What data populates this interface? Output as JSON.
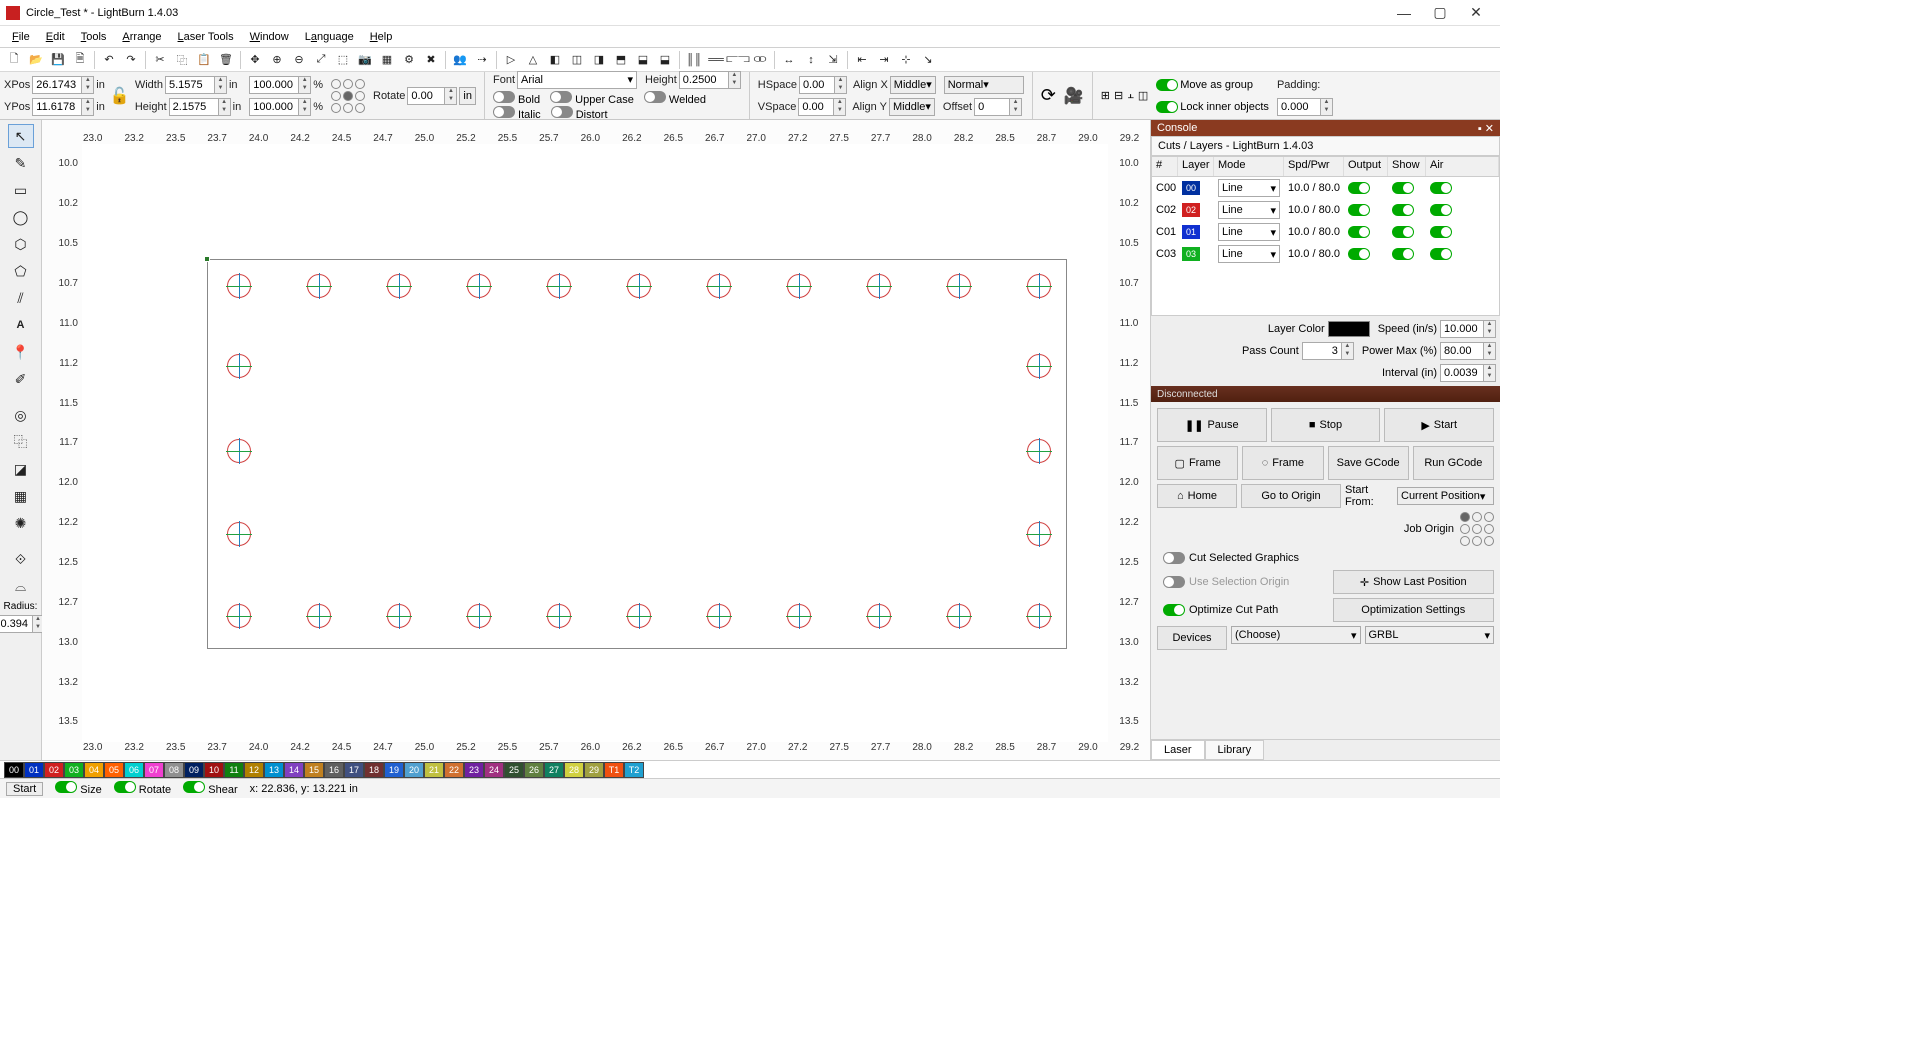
{
  "window": {
    "title": "Circle_Test * - LightBurn 1.4.03"
  },
  "menus": [
    "File",
    "Edit",
    "Tools",
    "Arrange",
    "Laser Tools",
    "Window",
    "Language",
    "Help"
  ],
  "props": {
    "xpos_label": "XPos",
    "xpos": "26.1743",
    "xpos_unit": "in",
    "ypos_label": "YPos",
    "ypos": "11.6178",
    "ypos_unit": "in",
    "width_label": "Width",
    "width": "5.1575",
    "width_unit": "in",
    "height_label": "Height",
    "height": "2.1575",
    "height_unit": "in",
    "scale_x": "100.000",
    "scale_x_unit": "%",
    "scale_y": "100.000",
    "scale_y_unit": "%",
    "rotate_label": "Rotate",
    "rotate": "0.00",
    "rotate_unit": "in",
    "font_label": "Font",
    "font": "Arial",
    "fheight_label": "Height",
    "fheight": "0.2500",
    "bold": "Bold",
    "italic": "Italic",
    "upper": "Upper Case",
    "distort": "Distort",
    "welded": "Welded",
    "hspace_label": "HSpace",
    "hspace": "0.00",
    "vspace_label": "VSpace",
    "vspace": "0.00",
    "alignx_label": "Align X",
    "alignx": "Middle",
    "aligny_label": "Align Y",
    "aligny": "Middle",
    "normal": "Normal",
    "offset_label": "Offset",
    "offset": "0",
    "move_as_group": "Move as group",
    "lock_inner": "Lock inner objects",
    "padding_label": "Padding:",
    "padding": "0.000"
  },
  "ruler_top": [
    "23.0",
    "23.2",
    "23.5",
    "23.7",
    "24.0",
    "24.2",
    "24.5",
    "24.7",
    "25.0",
    "25.2",
    "25.5",
    "25.7",
    "26.0",
    "26.2",
    "26.5",
    "26.7",
    "27.0",
    "27.2",
    "27.5",
    "27.7",
    "28.0",
    "28.2",
    "28.5",
    "28.7",
    "29.0",
    "29.2"
  ],
  "ruler_left": [
    "10.0",
    "10.2",
    "10.5",
    "10.7",
    "11.0",
    "11.2",
    "11.5",
    "11.7",
    "12.0",
    "12.2",
    "12.5",
    "12.7",
    "13.0",
    "13.2",
    "13.5"
  ],
  "cuts": {
    "title": "Cuts / Layers - LightBurn 1.4.03",
    "headers": [
      "#",
      "Layer",
      "Mode",
      "Spd/Pwr",
      "Output",
      "Show",
      "Air"
    ],
    "rows": [
      {
        "id": "C00",
        "label": "00",
        "color": "#0030a0",
        "mode": "Line",
        "spdpwr": "10.0 / 80.0"
      },
      {
        "id": "C02",
        "label": "02",
        "color": "#d02020",
        "mode": "Line",
        "spdpwr": "10.0 / 80.0"
      },
      {
        "id": "C01",
        "label": "01",
        "color": "#1030d0",
        "mode": "Line",
        "spdpwr": "10.0 / 80.0"
      },
      {
        "id": "C03",
        "label": "03",
        "color": "#10b020",
        "mode": "Line",
        "spdpwr": "10.0 / 80.0"
      }
    ],
    "layer_color_label": "Layer Color",
    "speed_label": "Speed (in/s)",
    "speed": "10.000",
    "pass_label": "Pass Count",
    "pass": "3",
    "power_label": "Power Max (%)",
    "power": "80.00",
    "interval_label": "Interval (in)",
    "interval": "0.0039"
  },
  "laser": {
    "disconnected": "Disconnected",
    "console": "Console",
    "pause": "Pause",
    "stop": "Stop",
    "start": "Start",
    "frame": "Frame",
    "save_gcode": "Save GCode",
    "run_gcode": "Run GCode",
    "home": "Home",
    "go_origin": "Go to Origin",
    "start_from": "Start From:",
    "start_from_val": "Current Position",
    "job_origin": "Job Origin",
    "cut_sel": "Cut Selected Graphics",
    "use_sel_origin": "Use Selection Origin",
    "show_last": "Show Last Position",
    "optimize": "Optimize Cut Path",
    "opt_settings": "Optimization Settings",
    "devices": "Devices",
    "choose": "(Choose)",
    "grbl": "GRBL",
    "tab_laser": "Laser",
    "tab_library": "Library"
  },
  "left_labels": {
    "radius": "Radius:",
    "radius_val": "0.394"
  },
  "palette": [
    {
      "n": "00",
      "c": "#000000"
    },
    {
      "n": "01",
      "c": "#0030c0"
    },
    {
      "n": "02",
      "c": "#d02020"
    },
    {
      "n": "03",
      "c": "#10b020"
    },
    {
      "n": "04",
      "c": "#f0a000"
    },
    {
      "n": "05",
      "c": "#ff6000"
    },
    {
      "n": "06",
      "c": "#00d0d0"
    },
    {
      "n": "07",
      "c": "#f040d0"
    },
    {
      "n": "08",
      "c": "#909090"
    },
    {
      "n": "09",
      "c": "#002060"
    },
    {
      "n": "10",
      "c": "#a01010"
    },
    {
      "n": "11",
      "c": "#108010"
    },
    {
      "n": "12",
      "c": "#b08000"
    },
    {
      "n": "13",
      "c": "#0090d0"
    },
    {
      "n": "14",
      "c": "#8040c0"
    },
    {
      "n": "15",
      "c": "#c08020"
    },
    {
      "n": "16",
      "c": "#606060"
    },
    {
      "n": "17",
      "c": "#405080"
    },
    {
      "n": "18",
      "c": "#703030"
    },
    {
      "n": "19",
      "c": "#2060d0"
    },
    {
      "n": "20",
      "c": "#50a0d0"
    },
    {
      "n": "21",
      "c": "#c0c040"
    },
    {
      "n": "22",
      "c": "#d07030"
    },
    {
      "n": "23",
      "c": "#7020a0"
    },
    {
      "n": "24",
      "c": "#a03080"
    },
    {
      "n": "25",
      "c": "#305030"
    },
    {
      "n": "26",
      "c": "#608040"
    },
    {
      "n": "27",
      "c": "#108060"
    },
    {
      "n": "28",
      "c": "#d0d040"
    },
    {
      "n": "29",
      "c": "#a0a040"
    },
    {
      "n": "T1",
      "c": "#f05010"
    },
    {
      "n": "T2",
      "c": "#20a0d0"
    }
  ],
  "status": {
    "start": "Start",
    "size": "Size",
    "rotate": "Rotate",
    "shear": "Shear",
    "coord": "x: 22.836, y: 13.221 in"
  }
}
